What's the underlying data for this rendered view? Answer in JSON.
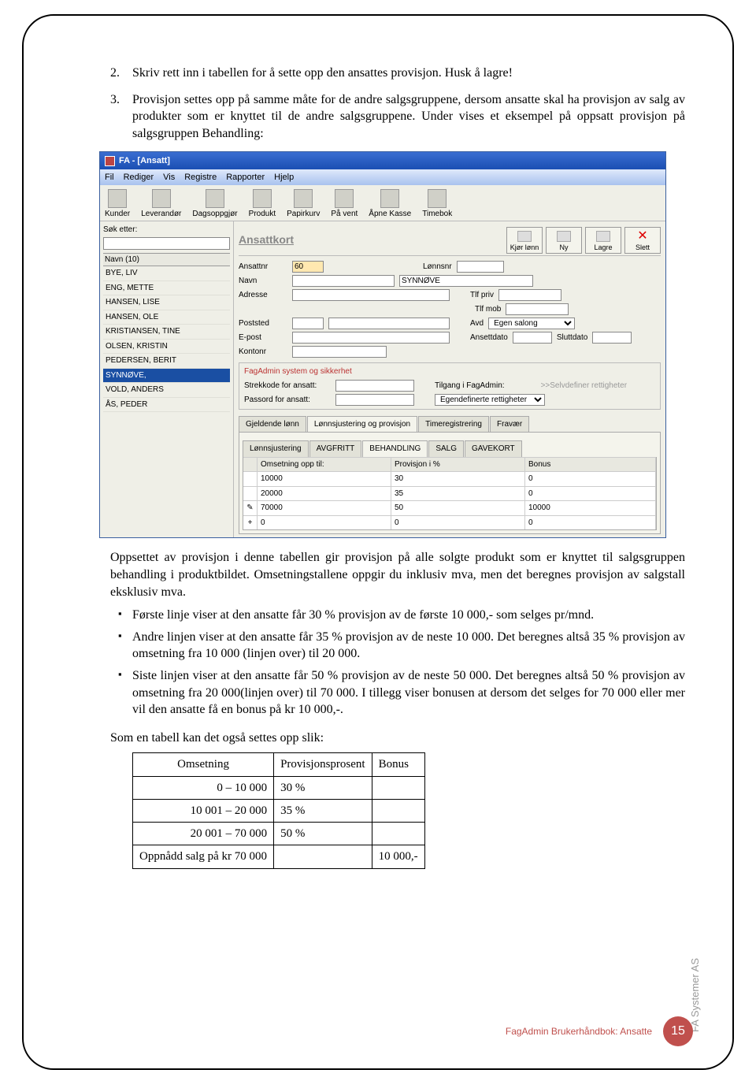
{
  "ol": [
    {
      "num": "2.",
      "text": "Skriv rett inn i tabellen for å sette opp den ansattes provisjon. Husk å lagre!"
    },
    {
      "num": "3.",
      "text": "Provisjon settes opp på samme måte for de andre salgsgruppene, dersom ansatte skal ha provisjon av salg av produkter som er knyttet til de andre salgsgruppene. Under vises et eksempel på oppsatt provisjon på salgsgruppen Behandling:"
    }
  ],
  "app": {
    "title": "FA - [Ansatt]",
    "menu": [
      "Fil",
      "Rediger",
      "Vis",
      "Registre",
      "Rapporter",
      "Hjelp"
    ],
    "tools": [
      "Kunder",
      "Leverandør",
      "Dagsoppgjør",
      "Produkt",
      "Papirkurv",
      "På vent",
      "Åpne Kasse",
      "Timebok"
    ],
    "search_label": "Søk etter:",
    "navn_header": "Navn (10)",
    "names": [
      "BYE, LIV",
      "ENG, METTE",
      "HANSEN, LISE",
      "HANSEN, OLE",
      "KRISTIANSEN, TINE",
      "OLSEN, KRISTIN",
      "PEDERSEN, BERIT",
      "SYNNØVE,",
      "VOLD, ANDERS",
      "ÅS, PEDER"
    ],
    "selected_index": 7,
    "card_title": "Ansattkort",
    "btns": {
      "kjor": "Kjør lønn",
      "ny": "Ny",
      "lagre": "Lagre",
      "slett": "Slett"
    },
    "fields": {
      "ansattnr_lbl": "Ansattnr",
      "ansattnr_val": "60",
      "lonnsnr_lbl": "Lønnsnr",
      "navn_lbl": "Navn",
      "navn_val": "SYNNØVE",
      "adresse_lbl": "Adresse",
      "tlfpriv_lbl": "Tlf priv",
      "tlfmob_lbl": "Tlf mob",
      "poststed_lbl": "Poststed",
      "avd_lbl": "Avd",
      "avd_val": "Egen salong",
      "epost_lbl": "E-post",
      "ansdato_lbl": "Ansettdato",
      "sluttdato_lbl": "Sluttdato",
      "kontonr_lbl": "Kontonr",
      "box_legend": "FagAdmin system og sikkerhet",
      "strekkode_lbl": "Strekkode for ansatt:",
      "passord_lbl": "Passord for ansatt:",
      "tilgang_lbl": "Tilgang i FagAdmin:",
      "tilgang_val": "Egendefinerte rettigheter",
      "selvdef": ">>Selvdefiner rettigheter"
    },
    "tabs": [
      "Gjeldende lønn",
      "Lønnsjustering og provisjon",
      "Timeregistrering",
      "Fravær"
    ],
    "active_tab": 1,
    "subtabs": [
      "Lønnsjustering",
      "AVGFRITT",
      "BEHANDLING",
      "SALG",
      "GAVEKORT"
    ],
    "active_subtab": 2,
    "grid": {
      "headers": [
        "",
        "Omsetning opp til:",
        "Provisjon i %",
        "Bonus"
      ],
      "rows": [
        [
          "",
          "10000",
          "30",
          "0"
        ],
        [
          "",
          "20000",
          "35",
          "0"
        ],
        [
          "✎",
          "70000",
          "50",
          "10000"
        ],
        [
          "+",
          "0",
          "0",
          "0"
        ]
      ]
    }
  },
  "after_para1": "Oppsettet av provisjon i denne tabellen gir provisjon på alle solgte produkt som er knyttet til salgsgruppen behandling i produktbildet. Omsetningstallene oppgir du inklusiv mva, men det beregnes provisjon av salgstall eksklusiv mva.",
  "bullets": [
    "Første linje viser at den ansatte får 30 % provisjon av de første 10 000,- som selges pr/mnd.",
    "Andre linjen viser at den ansatte får 35 % provisjon av de neste 10 000. Det beregnes altså 35 % provisjon av omsetning fra 10 000 (linjen over) til 20 000.",
    "Siste linjen viser at den ansatte får 50 % provisjon av de neste 50 000. Det beregnes altså 50 % provisjon av omsetning fra 20 000(linjen over) til 70 000. I tillegg viser bonusen at dersom det selges for 70 000 eller mer vil den ansatte få en bonus på kr 10 000,-."
  ],
  "summary_intro": "Som en tabell kan det også settes opp slik:",
  "summary": {
    "headers": [
      "Omsetning",
      "Provisjonsprosent",
      "Bonus"
    ],
    "rows": [
      [
        "0 – 10 000",
        "30 %",
        ""
      ],
      [
        "10 001 – 20 000",
        "35 %",
        ""
      ],
      [
        "20 001 – 70 000",
        "50 %",
        ""
      ],
      [
        "Oppnådd salg på kr 70 000",
        "",
        "10 000,-"
      ]
    ]
  },
  "footer": {
    "label": "FagAdmin Brukerhåndbok: Ansatte",
    "page": "15",
    "brand": "FA Systemer AS"
  }
}
